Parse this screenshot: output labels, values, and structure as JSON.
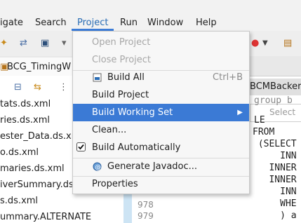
{
  "menubar": {
    "items": [
      "igate",
      "Search",
      "Project",
      "Run",
      "Window",
      "Help"
    ]
  },
  "toolbar": {
    "tab_title": "BCG_TimingW"
  },
  "explorer": {
    "files": [
      "tats.ds.xml",
      "ries.ds.xml",
      "ester_Data.ds.xn",
      "o.ds.xml",
      "maries.ds.xml",
      "iverSummary.ds",
      "s.ds.xml",
      "ummary.ALTERNATE"
    ]
  },
  "editor": {
    "tab_title": "BCMBacker",
    "placeholder": "Select",
    "line_numbers": [
      "978",
      "979"
    ],
    "code_lines": [
      "group b",
      "LE",
      "FROM",
      " (SELECT",
      "     INN",
      "   INNER",
      "   INNER",
      "     INN",
      "     WHE",
      "     ) a"
    ]
  },
  "project_menu": {
    "items": [
      {
        "label": "Open Project",
        "enabled": false
      },
      {
        "label": "Close Project",
        "enabled": false
      },
      {
        "label": "Build All",
        "accel": "Ctrl+B",
        "icon": "build-all-icon"
      },
      {
        "label": "Build Project"
      },
      {
        "label": "Build Working Set",
        "submenu": true,
        "highlighted": true
      },
      {
        "label": "Clean..."
      },
      {
        "label": "Build Automatically",
        "checked": true
      },
      {
        "label": "Generate Javadoc...",
        "icon": "javadoc-icon"
      },
      {
        "label": "Properties"
      }
    ]
  },
  "colors": {
    "accent": "#3b7ad5",
    "menubar_active": "#2a6db5"
  }
}
